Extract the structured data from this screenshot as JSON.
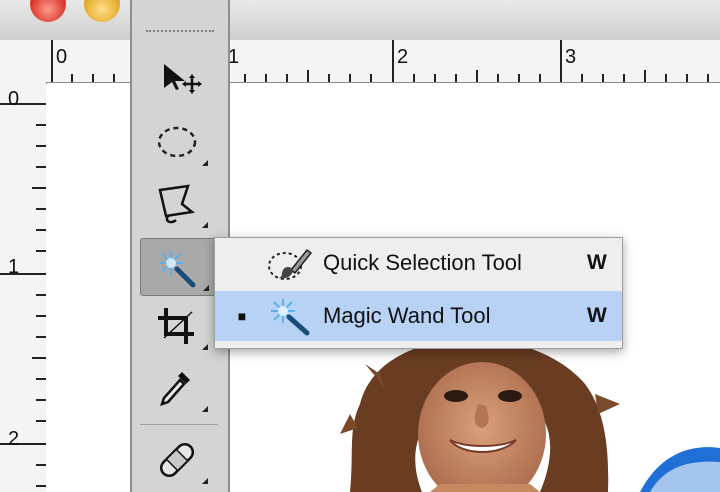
{
  "window": {
    "close_button": "close",
    "minimize_button": "minimize"
  },
  "ruler": {
    "horizontal_labels": [
      "0",
      "1",
      "2",
      "3"
    ],
    "vertical_labels": [
      "0",
      "1",
      "2"
    ],
    "unit": "inches"
  },
  "tools_panel": {
    "tools": [
      {
        "name": "move-tool",
        "icon": "move-icon"
      },
      {
        "name": "marquee-tool",
        "icon": "elliptical-marquee-icon"
      },
      {
        "name": "lasso-tool",
        "icon": "polygonal-lasso-icon"
      },
      {
        "name": "magic-wand-tool",
        "icon": "magic-wand-icon",
        "selected": true
      },
      {
        "name": "crop-tool",
        "icon": "crop-icon"
      },
      {
        "name": "eyedropper-tool",
        "icon": "eyedropper-icon"
      },
      {
        "name": "healing-brush-tool",
        "icon": "bandage-icon"
      }
    ]
  },
  "flyout_menu": {
    "items": [
      {
        "label": "Quick Selection Tool",
        "shortcut": "W",
        "icon": "quick-selection-icon",
        "checked": false
      },
      {
        "label": "Magic Wand Tool",
        "shortcut": "W",
        "icon": "magic-wand-icon",
        "checked": true,
        "check_mark": "■"
      }
    ]
  },
  "colors": {
    "highlight": "#b7d2f5",
    "panel": "#d4d4d4",
    "menu_bg": "#eeeeee"
  }
}
